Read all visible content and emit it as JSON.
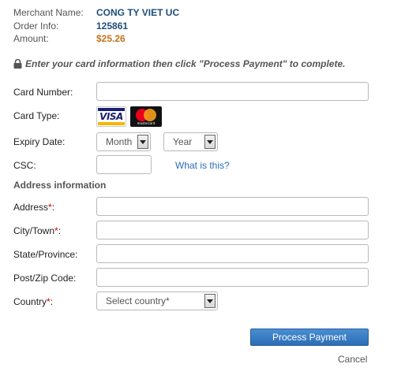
{
  "order": {
    "merchant_label": "Merchant Name:",
    "merchant_value": "CONG TY VIET UC",
    "order_label": "Order Info:",
    "order_value": "125861",
    "amount_label": "Amount:",
    "amount_value": "$25.26"
  },
  "notice": "Enter your card information then click \"Process Payment\" to complete.",
  "card": {
    "number_label": "Card Number:",
    "type_label": "Card Type:",
    "types": [
      "VISA",
      "mastercard"
    ],
    "expiry_label": "Expiry Date:",
    "month_value": "Month",
    "year_value": "Year",
    "csc_label": "CSC:",
    "csc_help": "What is this?"
  },
  "address": {
    "section_title": "Address information",
    "address_label": "Address",
    "city_label": "City/Town",
    "state_label": "State/Province:",
    "zip_label": "Post/Zip Code:",
    "country_label": "Country",
    "country_value": "Select country*",
    "required_mark": "*",
    "colon": ":"
  },
  "actions": {
    "process_label": "Process Payment",
    "cancel_label": "Cancel"
  },
  "colors": {
    "accent": "#2c6db5",
    "merchant": "#1f4e79",
    "amount": "#c2731d",
    "required": "#cc0000",
    "link": "#2a6ebb"
  }
}
